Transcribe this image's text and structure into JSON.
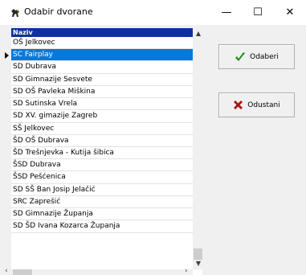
{
  "window": {
    "title": "Odabir dvorane",
    "minimize_glyph": "—",
    "maximize_glyph": "☐",
    "close_glyph": "✕"
  },
  "grid": {
    "column_header": "Naziv",
    "selected_index": 1,
    "rows": [
      "OŠ Jelkovec",
      "SC Fairplay",
      "SD Dubrava",
      "SD Gimnazije Sesvete",
      "SD OŠ Pavleka Miškina",
      "SD Sutinska Vrela",
      "SD XV. gimazije Zagreb",
      "SŠ Jelkovec",
      "ŠD OŠ Dubrava",
      "ŠD Trešnjevka - Kutija šibica",
      "ŠSD Dubrava",
      "ŠSD Pešćenica",
      "SD SŠ Ban Josip Jelačić",
      "SRC Zaprešić",
      "SD Gimnazije Županja",
      "SD ŠD Ivana Kozarca Županja"
    ]
  },
  "buttons": {
    "select_label": "Odaberi",
    "cancel_label": "Odustani"
  },
  "icons": {
    "app": "horse-icon",
    "select": "checkmark-icon",
    "cancel": "cross-icon"
  },
  "colors": {
    "header_bg": "#0e31a0",
    "selection_bg": "#0a78d6",
    "check_green": "#1f8f1f",
    "cross_red": "#b01010"
  }
}
